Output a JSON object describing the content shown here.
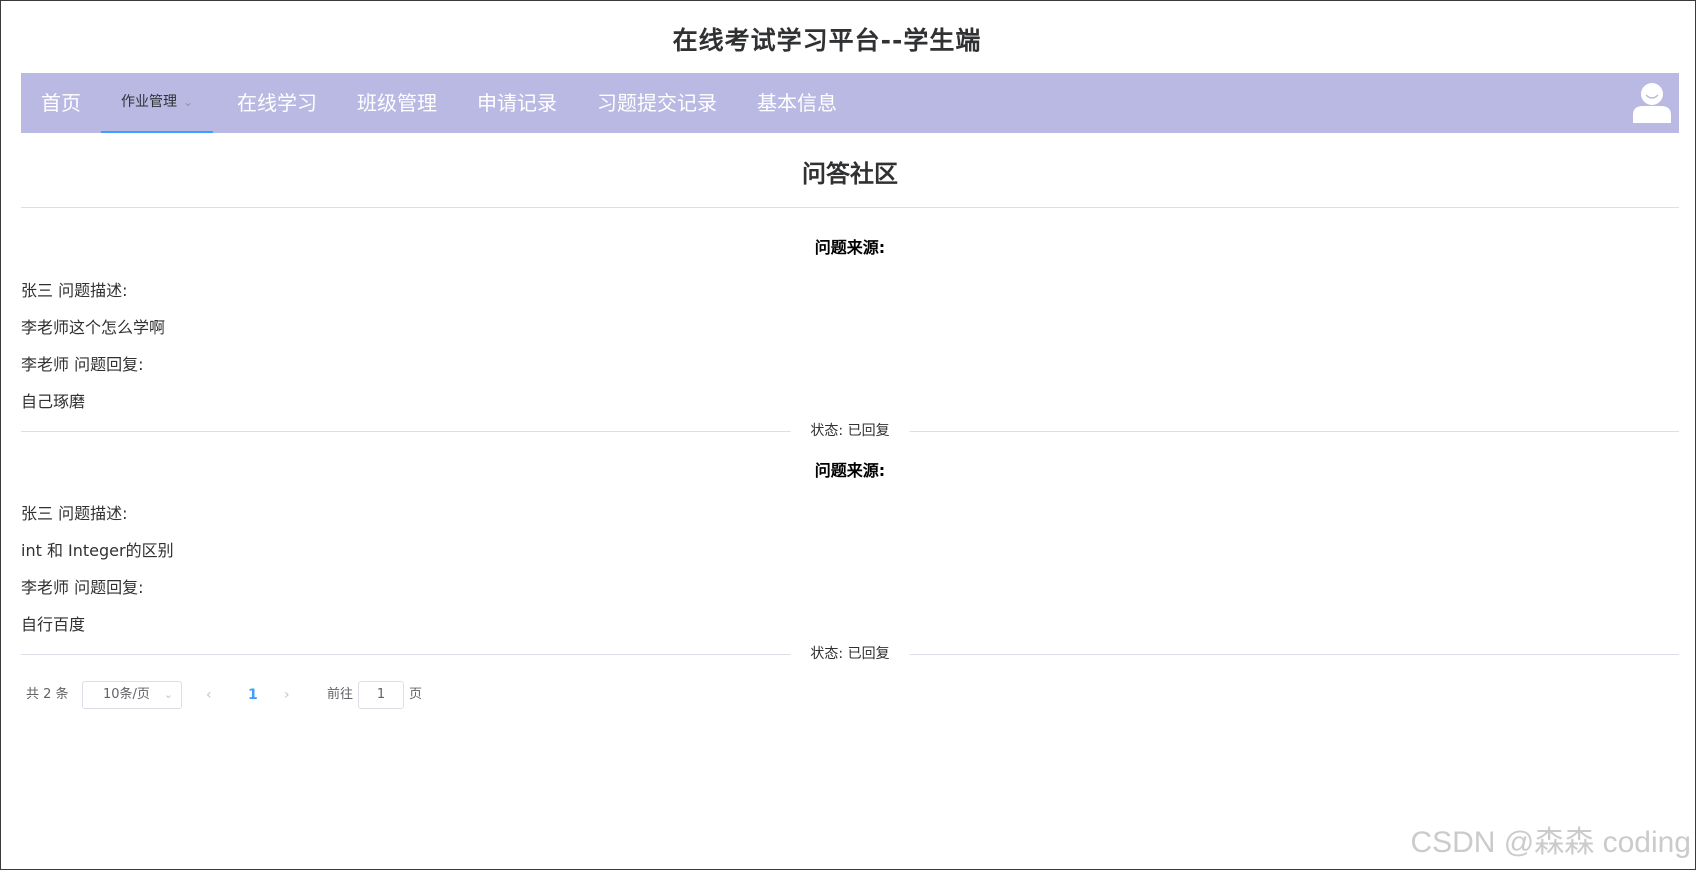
{
  "app": {
    "title": "在线考试学习平台--学生端"
  },
  "nav": {
    "items": [
      {
        "label": "首页"
      },
      {
        "label": "作业管理"
      },
      {
        "label": "在线学习"
      },
      {
        "label": "班级管理"
      },
      {
        "label": "申请记录"
      },
      {
        "label": "习题提交记录"
      },
      {
        "label": "基本信息"
      }
    ],
    "active_color": "#409eff",
    "bg_color": "#b9b9e3"
  },
  "page": {
    "title": "问答社区"
  },
  "questions": [
    {
      "source_label": "问题来源:",
      "asker_line": "张三 问题描述:",
      "question": "李老师这个怎么学啊",
      "replier_line": "李老师 问题回复:",
      "reply": "自己琢磨",
      "status": "状态: 已回复"
    },
    {
      "source_label": "问题来源:",
      "asker_line": "张三 问题描述:",
      "question": "int 和 Integer的区别",
      "replier_line": "李老师 问题回复:",
      "reply": "自行百度",
      "status": "状态: 已回复"
    }
  ],
  "pagination": {
    "total": "共 2 条",
    "page_size": "10条/页",
    "current_page": "1",
    "goto_label": "前往",
    "goto_value": "1",
    "page_suffix": "页"
  },
  "watermark": "CSDN @森森 coding"
}
